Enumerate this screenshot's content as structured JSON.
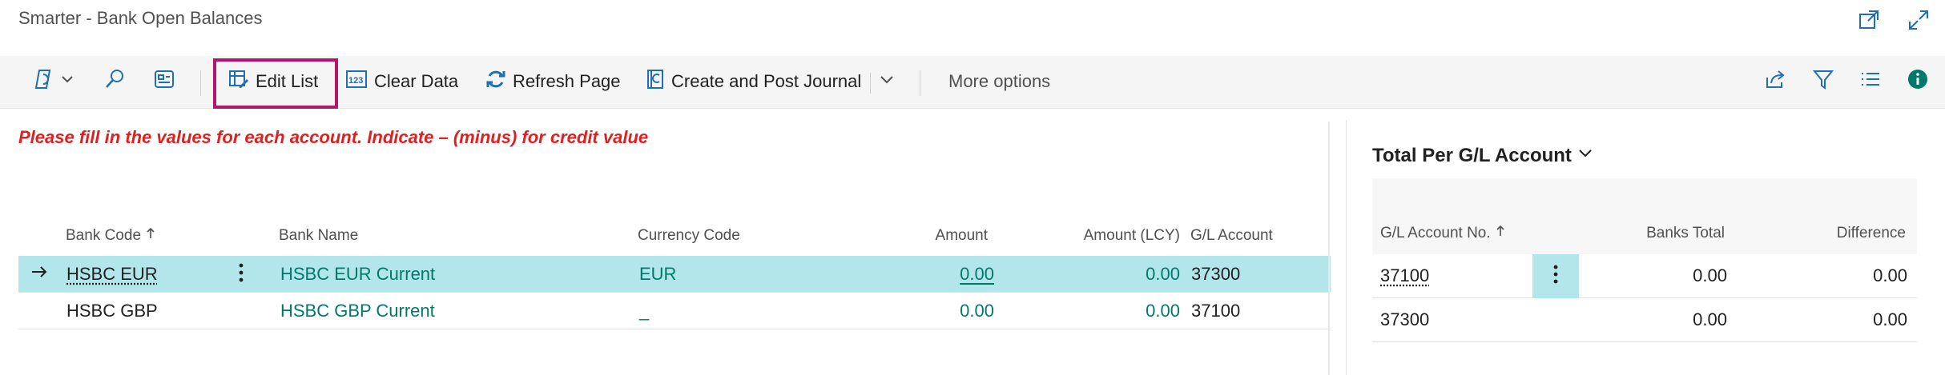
{
  "window": {
    "title": "Smarter - Bank Open Balances"
  },
  "toolbar": {
    "edit_list": "Edit List",
    "clear_data": "Clear Data",
    "refresh_page": "Refresh Page",
    "create_post_journal": "Create and Post Journal",
    "more_options": "More options"
  },
  "instruction": "Please fill in the values for each account. Indicate – (minus) for credit value",
  "grid": {
    "headers": {
      "bank_code": "Bank Code",
      "bank_name": "Bank Name",
      "currency_code": "Currency Code",
      "amount": "Amount",
      "amount_lcy": "Amount (LCY)",
      "gl_account": "G/L Account"
    },
    "rows": [
      {
        "bank_code": "HSBC EUR",
        "bank_name": "HSBC EUR Current",
        "currency_code": "EUR",
        "amount": "0.00",
        "amount_lcy": "0.00",
        "gl_account": "37300"
      },
      {
        "bank_code": "HSBC GBP",
        "bank_name": "HSBC GBP Current",
        "currency_code": "_",
        "amount": "0.00",
        "amount_lcy": "0.00",
        "gl_account": "37100"
      }
    ]
  },
  "panel": {
    "title": "Total Per G/L Account",
    "headers": {
      "gl_account_no": "G/L Account No.",
      "banks_total": "Banks Total",
      "difference": "Difference"
    },
    "rows": [
      {
        "gl_account_no": "37100",
        "banks_total": "0.00",
        "difference": "0.00"
      },
      {
        "gl_account_no": "37300",
        "banks_total": "0.00",
        "difference": "0.00"
      }
    ]
  },
  "colors": {
    "accent": "#00796b",
    "selection": "#b3e6ea",
    "warning_text": "#e02020",
    "highlight_border": "#b0186c"
  },
  "icons": {
    "title_bar": [
      "popout-icon",
      "expand-icon"
    ],
    "toolbar_left": [
      "copilot-icon",
      "chevron-down-icon",
      "search-icon",
      "page-view-icon"
    ],
    "toolbar_right": [
      "share-icon",
      "filter-icon",
      "list-icon",
      "info-icon"
    ]
  }
}
